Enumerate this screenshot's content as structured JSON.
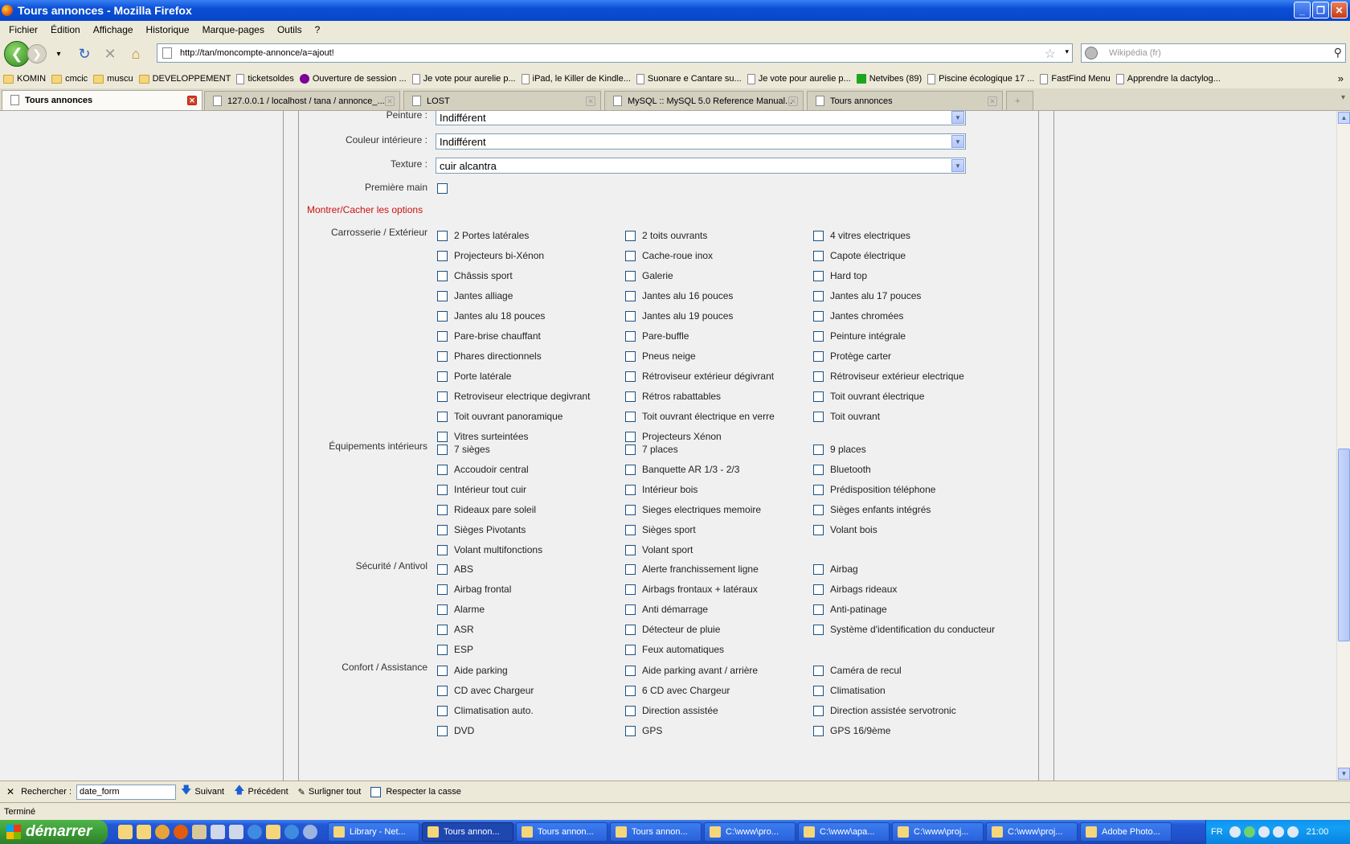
{
  "window": {
    "title": "Tours annonces - Mozilla Firefox"
  },
  "menu": [
    "Fichier",
    "Édition",
    "Affichage",
    "Historique",
    "Marque-pages",
    "Outils",
    "?"
  ],
  "nav": {
    "url": "http://tan/moncompte-annonce/a=ajout!",
    "search_placeholder": "Wikipédia (fr)"
  },
  "bookmarks": [
    {
      "label": "KOMIN",
      "type": "folder"
    },
    {
      "label": "cmcic",
      "type": "folder"
    },
    {
      "label": "muscu",
      "type": "folder"
    },
    {
      "label": "DEVELOPPEMENT",
      "type": "folder"
    },
    {
      "label": "ticketsoldes",
      "type": "doc"
    },
    {
      "label": "Ouverture de session ...",
      "type": "yahoo"
    },
    {
      "label": "Je vote pour aurelie p...",
      "type": "doc"
    },
    {
      "label": "iPad, le Killer de Kindle...",
      "type": "doc"
    },
    {
      "label": "Suonare e Cantare su...",
      "type": "doc"
    },
    {
      "label": "Je vote pour aurelie p...",
      "type": "doc"
    },
    {
      "label": "Netvibes (89)",
      "type": "netvibes"
    },
    {
      "label": "Piscine écologique 17 ...",
      "type": "doc"
    },
    {
      "label": "FastFind Menu",
      "type": "doc"
    },
    {
      "label": "Apprendre la dactylog...",
      "type": "doc"
    }
  ],
  "tabs": [
    {
      "label": "Tours annonces",
      "active": true
    },
    {
      "label": "127.0.0.1 / localhost / tana / annonce_...",
      "active": false
    },
    {
      "label": "LOST",
      "active": false
    },
    {
      "label": "MySQL :: MySQL 5.0 Reference Manual...",
      "active": false
    },
    {
      "label": "Tours annonces",
      "active": false
    }
  ],
  "form": {
    "peinture": {
      "label": "Peinture :",
      "value": "Indifférent"
    },
    "couleur_interieure": {
      "label": "Couleur intérieure :",
      "value": "Indifférent"
    },
    "texture": {
      "label": "Texture :",
      "value": "cuir alcantra"
    },
    "premiere_main": {
      "label": "Première main",
      "checked": false
    },
    "toggle_options": "Montrer/Cacher les options"
  },
  "option_groups": [
    {
      "label": "Carrosserie / Extérieur",
      "options": [
        "2 Portes latérales",
        "2 toits ouvrants",
        "4 vitres electriques",
        "Projecteurs bi-Xénon",
        "Cache-roue inox",
        "Capote électrique",
        "Châssis sport",
        "Galerie",
        "Hard top",
        "Jantes alliage",
        "Jantes alu 16 pouces",
        "Jantes alu 17 pouces",
        "Jantes alu 18 pouces",
        "Jantes alu 19 pouces",
        "Jantes chromées",
        "Pare-brise chauffant",
        "Pare-buffle",
        "Peinture intégrale",
        "Phares directionnels",
        "Pneus neige",
        "Protège carter",
        "Porte latérale",
        "Rétroviseur extérieur dégivrant",
        "Rétroviseur extérieur electrique",
        "Retroviseur electrique degivrant",
        "Rétros rabattables",
        "Toit ouvrant électrique",
        "Toit ouvrant panoramique",
        "Toit ouvrant électrique en verre",
        "Toit ouvrant",
        "Vitres surteintées",
        "Projecteurs Xénon"
      ]
    },
    {
      "label": "Équipements intérieurs",
      "options": [
        "7 sièges",
        "7 places",
        "9 places",
        "Accoudoir central",
        "Banquette AR 1/3 - 2/3",
        "Bluetooth",
        "Intérieur tout cuir",
        "Intérieur bois",
        "Prédisposition téléphone",
        "Rideaux pare soleil",
        "Sieges electriques memoire",
        "Sièges enfants intégrés",
        "Sièges Pivotants",
        "Sièges sport",
        "Volant bois",
        "Volant multifonctions",
        "Volant sport"
      ]
    },
    {
      "label": "Sécurité / Antivol",
      "options": [
        "ABS",
        "Alerte franchissement ligne",
        "Airbag",
        "Airbag frontal",
        "Airbags frontaux + latéraux",
        "Airbags rideaux",
        "Alarme",
        "Anti démarrage",
        "Anti-patinage",
        "ASR",
        "Détecteur de pluie",
        "Système d'identification du conducteur",
        "ESP",
        "Feux automatiques"
      ]
    },
    {
      "label": "Confort / Assistance",
      "options": [
        "Aide parking",
        "Aide parking avant / arrière",
        "Caméra de recul",
        "CD avec Chargeur",
        "6 CD avec Chargeur",
        "Climatisation",
        "Climatisation auto.",
        "Direction assistée",
        "Direction assistée servotronic",
        "DVD",
        "GPS",
        "GPS 16/9ème"
      ]
    }
  ],
  "findbar": {
    "label": "Rechercher :",
    "value": "date_form",
    "next": "Suivant",
    "prev": "Précédent",
    "highlight": "Surligner tout",
    "match_case": "Respecter la casse"
  },
  "status": "Terminé",
  "taskbar": {
    "start": "démarrer",
    "tasks": [
      "Library - Net...",
      "Tours annon...",
      "Tours annon...",
      "Tours annon...",
      "C:\\www\\pro...",
      "C:\\www\\apa...",
      "C:\\www\\proj...",
      "C:\\www\\proj...",
      "Adobe Photo..."
    ],
    "lang": "FR",
    "clock": "21:00"
  }
}
